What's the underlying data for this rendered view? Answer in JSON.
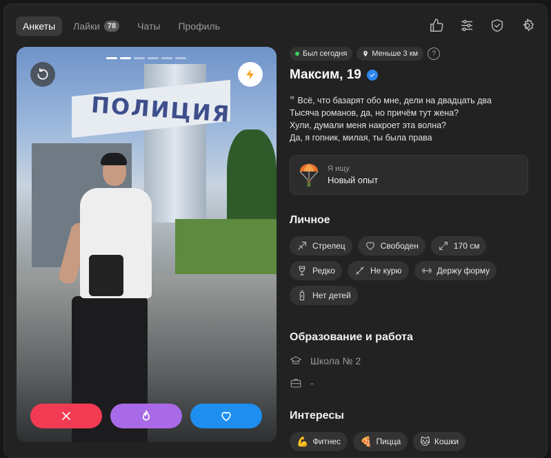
{
  "nav": {
    "tabs": [
      {
        "label": "Анкеты",
        "active": true
      },
      {
        "label": "Лайки",
        "badge": "78"
      },
      {
        "label": "Чаты"
      },
      {
        "label": "Профиль"
      }
    ]
  },
  "photo": {
    "sign_text": "ПОЛИЦИЯ",
    "page_count": 6,
    "current_page": 2
  },
  "profile": {
    "status": "Был сегодня",
    "distance": "Меньше 3 км",
    "help": "?",
    "name": "Максим, 19",
    "bio": [
      "Всё, что базарят обо мне, дели на двадцать два",
      "Тысяча романов, да, но причём тут жена?",
      "Хули, думали меня накроет эта волна?",
      "Да, я гопник, милая, ты была права"
    ],
    "bio_quote": "❞",
    "looking_label": "Я ищу",
    "looking_value": "Новый опыт"
  },
  "personal": {
    "title": "Личное",
    "tags": [
      "Стрелец",
      "Свободен",
      "170 см",
      "Редко",
      "Не курю",
      "Держу форму",
      "Нет детей"
    ]
  },
  "education": {
    "title": "Образование и работа",
    "school": "Школа № 2",
    "work": "-"
  },
  "interests": {
    "title": "Интересы",
    "tags": [
      {
        "emoji": "💪",
        "label": "Фитнес"
      },
      {
        "emoji": "🍕",
        "label": "Пицца"
      },
      {
        "emoji": "🐱",
        "label": "Кошки"
      }
    ]
  },
  "colors": {
    "dislike": "#f23b53",
    "super": "#a86ae6",
    "like": "#1e8ff0",
    "online": "#3ecf57",
    "verified": "#2d86f0"
  }
}
